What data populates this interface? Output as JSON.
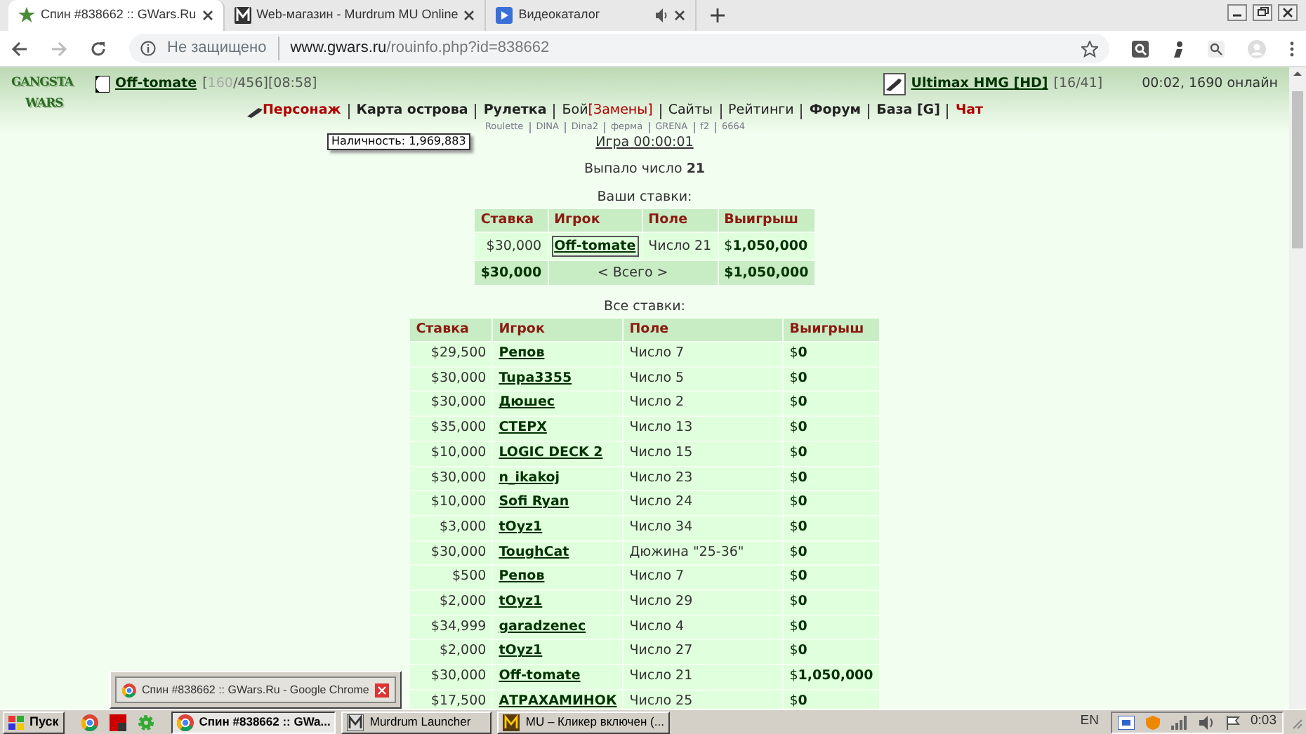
{
  "browser": {
    "tabs": [
      {
        "title": "Спин #838662 :: GWars.Ru",
        "selected": true,
        "kind": "game"
      },
      {
        "title": "Web-магазин - Murdrum MU Online",
        "selected": false,
        "kind": "shop"
      },
      {
        "title": "Видеокаталог",
        "selected": false,
        "kind": "video",
        "audio": true
      }
    ],
    "security": "Не защищено",
    "url_host": "www.gwars.ru",
    "url_path": "/rouinfo.php?id=838662"
  },
  "header": {
    "logo": [
      "GANGSTA",
      "WARS"
    ],
    "player": {
      "name": "Off-tomate",
      "stats_before": "[",
      "hp": "160",
      "stats_after": "/456][08:58]"
    },
    "weapon": {
      "name": "Ultimax HMG [HD]",
      "ammo": "[16/41]"
    },
    "online": "00:02, 1690 онлайн",
    "nav": [
      {
        "links": [
          {
            "label": "Персонаж",
            "bold": true,
            "highlight": true
          }
        ]
      },
      {
        "links": [
          {
            "label": "Карта острова",
            "bold": true,
            "highlight": false
          }
        ]
      },
      {
        "links": [
          {
            "label": "Рулетка",
            "bold": true,
            "highlight": false
          }
        ]
      },
      {
        "links": [
          {
            "label": "Бой",
            "bold": false,
            "highlight": false
          },
          {
            "label": "[Замены]",
            "bold": false,
            "highlight": true
          }
        ]
      },
      {
        "links": [
          {
            "label": "Сайты",
            "bold": false,
            "highlight": false
          }
        ]
      },
      {
        "links": [
          {
            "label": "Рейтинги",
            "bold": false,
            "highlight": false
          }
        ]
      },
      {
        "links": [
          {
            "label": "Форум",
            "bold": true,
            "highlight": false
          }
        ]
      },
      {
        "links": [
          {
            "label": "База [G]",
            "bold": true,
            "highlight": false
          }
        ]
      },
      {
        "links": [
          {
            "label": "Чат",
            "bold": true,
            "highlight": true
          }
        ]
      }
    ],
    "subnav": [
      "Roulette",
      "DINA",
      "Dina2",
      "ферма",
      "GRENA",
      "f2",
      "6664"
    ],
    "tooltip": "Наличность: 1,969,883"
  },
  "game": {
    "link": "Игра 00:00:01",
    "result": "Выпало число **21**",
    "my_bets": {
      "title": "Ваши ставки:",
      "columns": [
        "Ставка",
        "Игрок",
        "Поле",
        "Выигрыш"
      ],
      "rows": [
        {
          "bet": "$30,000",
          "player": "Off-tomate",
          "field": "Число 21",
          "win": "$**1,050,000**",
          "focused": true
        }
      ],
      "total": {
        "bet": "$30,000",
        "label": "< Всего >",
        "win": "$1,050,000"
      }
    },
    "all_bets": {
      "title": "Все ставки:",
      "columns": [
        "Ставка",
        "Игрок",
        "Поле",
        "Выигрыш"
      ],
      "rows": [
        {
          "bet": "$29,500",
          "player": "Репов",
          "field": "Число 7",
          "win": "$**0**"
        },
        {
          "bet": "$30,000",
          "player": "Tupa3355",
          "field": "Число 5",
          "win": "$**0**"
        },
        {
          "bet": "$30,000",
          "player": "Дюшес",
          "field": "Число 2",
          "win": "$**0**"
        },
        {
          "bet": "$35,000",
          "player": "СТЕРХ",
          "field": "Число 13",
          "win": "$**0**"
        },
        {
          "bet": "$10,000",
          "player": "LOGIC DECK 2",
          "field": "Число 15",
          "win": "$**0**"
        },
        {
          "bet": "$30,000",
          "player": "n_ikakoj",
          "field": "Число 23",
          "win": "$**0**"
        },
        {
          "bet": "$10,000",
          "player": "Sofi Ryan",
          "field": "Число 24",
          "win": "$**0**"
        },
        {
          "bet": "$3,000",
          "player": "tOyz1",
          "field": "Число 34",
          "win": "$**0**"
        },
        {
          "bet": "$30,000",
          "player": "ToughCat",
          "field": "Дюжина \"25-36\"",
          "win": "$**0**"
        },
        {
          "bet": "$500",
          "player": "Репов",
          "field": "Число 7",
          "win": "$**0**"
        },
        {
          "bet": "$2,000",
          "player": "tOyz1",
          "field": "Число 29",
          "win": "$**0**"
        },
        {
          "bet": "$34,999",
          "player": "garadzenec",
          "field": "Число 4",
          "win": "$**0**"
        },
        {
          "bet": "$2,000",
          "player": "tOyz1",
          "field": "Число 27",
          "win": "$**0**"
        },
        {
          "bet": "$30,000",
          "player": "Off-tomate",
          "field": "Число 21",
          "win": "$**1,050,000**"
        },
        {
          "bet": "$17,500",
          "player": "АТРАХАМИНОК",
          "field": "Число 25",
          "win": "$**0**"
        }
      ]
    }
  },
  "preview": {
    "title": "Спин #838662 :: GWars.Ru - Google Chrome"
  },
  "taskbar": {
    "start": "Пуск",
    "tasks": [
      {
        "title": "Спин #838662 :: GWa...",
        "selected": true,
        "kind": "chrome"
      },
      {
        "title": "Murdrum Launcher",
        "selected": false,
        "kind": "app"
      },
      {
        "title": "MU – Кликер включен (...",
        "selected": false,
        "kind": "game"
      }
    ],
    "language": "EN",
    "clock": "0:03"
  }
}
